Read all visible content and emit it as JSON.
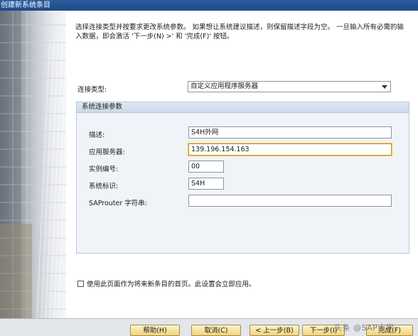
{
  "window": {
    "title": "创建新系统条目"
  },
  "intro": {
    "text": "选择连接类型并按要求更改系统参数。 如果想让系统建议描述，则保留描述字段为空。 一旦输入所有必需的输入数据，即会激活 '下一步(N) >' 和 '完成(F)' 按钮。"
  },
  "connection": {
    "label": "连接类型:",
    "value": "自定义应用程序服务器"
  },
  "group": {
    "title": "系统连接参数",
    "fields": [
      {
        "label": "描述:",
        "value": "S4H外网"
      },
      {
        "label": "应用服务器:",
        "value": "139.196.154.163"
      },
      {
        "label": "实例编号:",
        "value": "00"
      },
      {
        "label": "系统标识:",
        "value": "S4H"
      },
      {
        "label": "SAProuter 字符串:",
        "value": ""
      }
    ]
  },
  "checkbox": {
    "label": "使用此页面作为将来新条目的首页。此设置会立即应用。"
  },
  "buttons": {
    "help": "帮助(H)",
    "cancel": "取消(C)",
    "back": "< 上一步(B)",
    "next": "下一步(I)",
    "finish": "完成(F)"
  },
  "watermark": {
    "text": "头条 @SAP大学"
  }
}
